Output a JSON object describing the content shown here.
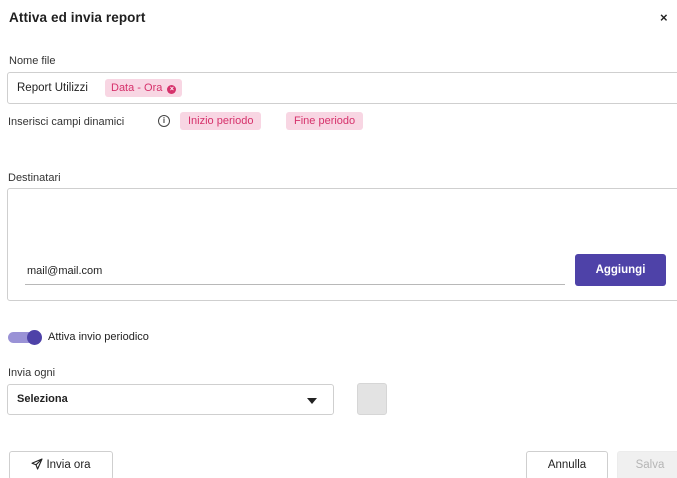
{
  "dialog": {
    "title": "Attiva ed invia report",
    "close_glyph": "×"
  },
  "file_name": {
    "label": "Nome file",
    "value": "Report Utilizzi",
    "tokens": [
      {
        "label": "Data - Ora",
        "removable": true
      }
    ]
  },
  "dynamic_fields": {
    "label": "Inserisci campi dinamici",
    "info_icon": "info-icon",
    "chips": [
      "Inizio periodo",
      "Fine periodo"
    ]
  },
  "recipients": {
    "label": "Destinatari",
    "input_value": "mail@mail.com",
    "add_label": "Aggiungi"
  },
  "periodic": {
    "toggle_label": "Attiva invio periodico",
    "enabled": true
  },
  "frequency": {
    "label": "Invia ogni",
    "selected": "Seleziona"
  },
  "footer": {
    "send_now_label": "Invia ora",
    "send_icon": "send-icon",
    "cancel_label": "Annulla",
    "save_label": "Salva"
  },
  "colors": {
    "accent": "#4e42a8",
    "chip_bg": "#f8d6e3",
    "chip_text": "#d6316b"
  }
}
